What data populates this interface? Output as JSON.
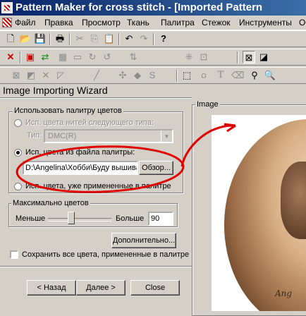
{
  "window": {
    "title": "Pattern Maker for cross stitch - [Imported Pattern"
  },
  "menu": [
    "Файл",
    "Правка",
    "Просмотр",
    "Ткань",
    "Палитра",
    "Стежок",
    "Инструменты",
    "Ok"
  ],
  "toolbar1": [
    {
      "icon": "new-file-icon",
      "glyph": "🗋",
      "disabled": false
    },
    {
      "icon": "open-folder-icon",
      "glyph": "📂",
      "disabled": false
    },
    {
      "icon": "save-icon",
      "glyph": "💾",
      "disabled": false
    },
    {
      "icon": "print-icon",
      "glyph": "🖶",
      "disabled": false
    },
    {
      "icon": "cut-icon",
      "glyph": "✂",
      "disabled": true
    },
    {
      "icon": "copy-icon",
      "glyph": "⎘",
      "disabled": true
    },
    {
      "icon": "paste-icon",
      "glyph": "📋",
      "disabled": true
    },
    {
      "icon": "undo-icon",
      "glyph": "↶",
      "disabled": false
    },
    {
      "icon": "redo-icon",
      "glyph": "↷",
      "disabled": true
    },
    {
      "icon": "help-icon",
      "glyph": "?",
      "disabled": false
    }
  ],
  "toolbar2": [
    {
      "icon": "delete-icon",
      "glyph": "✕",
      "disabled": false
    },
    {
      "icon": "palette-add-icon",
      "glyph": "▣",
      "disabled": false
    },
    {
      "icon": "palette-swap-icon",
      "glyph": "⇄",
      "disabled": false
    },
    {
      "icon": "grid-icon",
      "glyph": "▦",
      "disabled": true
    },
    {
      "icon": "zoom-area-icon",
      "glyph": "▭",
      "disabled": true
    },
    {
      "icon": "rotate-icon",
      "glyph": "↻",
      "disabled": true
    },
    {
      "icon": "rotate-back-icon",
      "glyph": "↺",
      "disabled": true
    },
    {
      "icon": "mirror-icon",
      "glyph": "⇅",
      "disabled": true
    },
    {
      "icon": "pattern-icon",
      "glyph": "⁜",
      "disabled": true
    },
    {
      "icon": "select-icon",
      "glyph": "⊡",
      "disabled": true
    },
    {
      "icon": "full-stitch-icon",
      "glyph": "⊠",
      "disabled": false
    },
    {
      "icon": "half-stitch-icon",
      "glyph": "◪",
      "disabled": false
    }
  ],
  "toolbar3": [
    {
      "icon": "stitch-full-icon",
      "glyph": "⊠",
      "disabled": true
    },
    {
      "icon": "stitch-quarter-icon",
      "glyph": "◩",
      "disabled": true
    },
    {
      "icon": "stitch-cross-icon",
      "glyph": "✕",
      "disabled": true
    },
    {
      "icon": "stitch-half-icon",
      "glyph": "◸",
      "disabled": true
    },
    {
      "icon": "backstitch-icon",
      "glyph": "╱",
      "disabled": true
    },
    {
      "icon": "french-knot-icon",
      "glyph": "✣",
      "disabled": true
    },
    {
      "icon": "bead-icon",
      "glyph": "◆",
      "disabled": true
    },
    {
      "icon": "specialty-icon",
      "glyph": "S",
      "disabled": true
    },
    {
      "icon": "rect-select-icon",
      "glyph": "⬚",
      "disabled": false
    },
    {
      "icon": "lasso-icon",
      "glyph": "◌",
      "disabled": false
    },
    {
      "icon": "text-icon",
      "glyph": "T",
      "disabled": true
    },
    {
      "icon": "eraser-icon",
      "glyph": "⌫",
      "disabled": true
    },
    {
      "icon": "eyedropper-icon",
      "glyph": "⚲",
      "disabled": false
    },
    {
      "icon": "zoom-icon",
      "glyph": "🔍",
      "disabled": false
    }
  ],
  "wizard": {
    "title": "Image Importing Wizard",
    "palette_group": {
      "label": "Использовать палитру цветов",
      "option_thread": "Исп. цвета нитей следующего типа:",
      "type_label": "Тип:",
      "type_value": "DMC(R)",
      "option_palette_file": "Исп. цвета из файла палитры:",
      "file_path": "D:\\Angelina\\Хобби\\Буду вышива",
      "browse_button": "Обзор...",
      "option_used": "Исп. цвета, уже примененные в палитре",
      "selected": "palette_file"
    },
    "max_colors_group": {
      "label": "Максимально цветов",
      "less": "Меньше",
      "more": "Больше",
      "value": "90",
      "slider_fraction": 0.35
    },
    "advanced_button": "Дополнительно...",
    "save_colors_checkbox": "Сохранить все цвета, примененные в палитре",
    "save_colors_checked": false,
    "back_button": "< Назад",
    "next_button": "Далее >",
    "close_button": "Close"
  },
  "image_panel": {
    "label": "Image",
    "signature": "Ang"
  },
  "colors": {
    "title_start": "#0a246a",
    "title_end": "#3a6ea5",
    "annotation": "#e00000",
    "face": "#d4d0c8"
  }
}
